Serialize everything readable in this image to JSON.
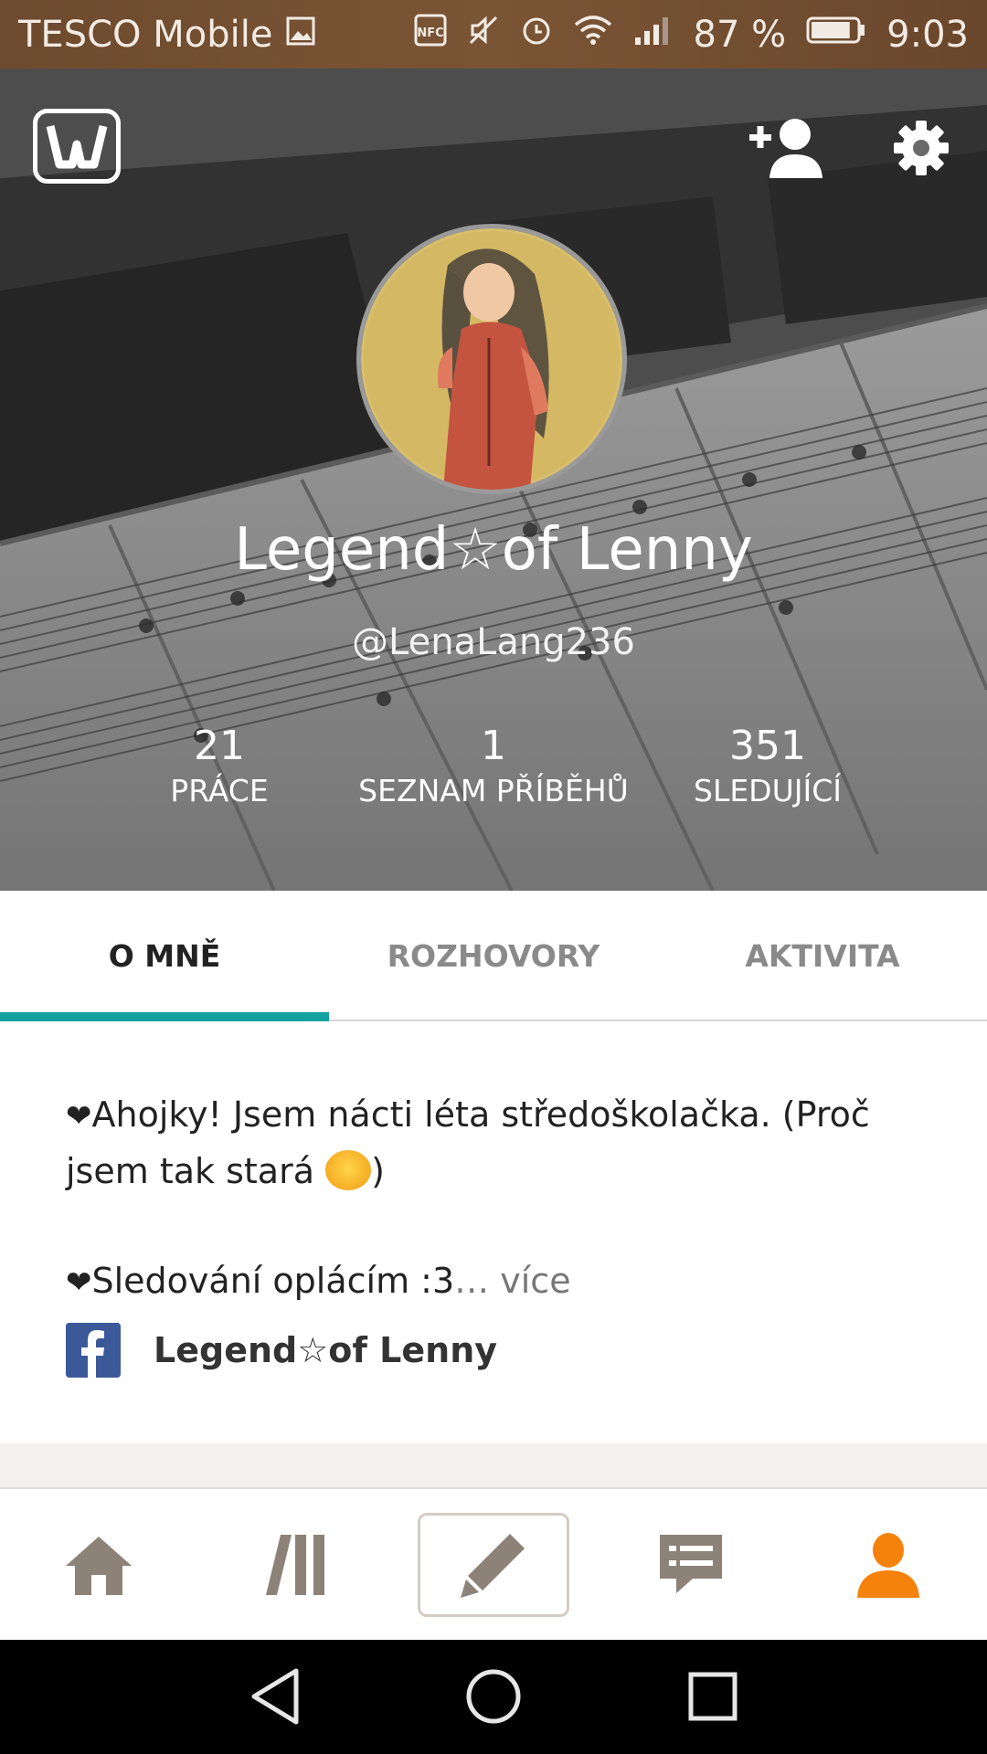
{
  "status_bar": {
    "carrier": "TESCO Mobile",
    "battery_percent": "87 %",
    "battery_level": 0.87,
    "time": "9:03",
    "icons": [
      "image-icon",
      "nfc-icon",
      "mute-icon",
      "alarm-icon",
      "wifi-icon",
      "signal-icon",
      "battery-icon"
    ]
  },
  "header": {
    "logo_icon": "wattpad-logo-icon",
    "actions": [
      "add-friend-icon",
      "settings-gear-icon"
    ]
  },
  "profile": {
    "display_name": "Legend☆of Lenny",
    "username": "@LenaLang236",
    "stats": [
      {
        "value": "21",
        "label": "PRÁCE"
      },
      {
        "value": "1",
        "label": "SEZNAM PŘÍBĚHŮ"
      },
      {
        "value": "351",
        "label": "SLEDUJÍCÍ"
      }
    ]
  },
  "tabs": [
    {
      "label": "O MNĚ",
      "active": true
    },
    {
      "label": "ROZHOVORY",
      "active": false
    },
    {
      "label": "AKTIVITA",
      "active": false
    }
  ],
  "about": {
    "line1": "Ahojky! Jsem nácti léta středoškolačka. (Proč jsem tak stará ",
    "line1_end": ")",
    "line2": "Sledování oplácím :3",
    "ellipsis": "…",
    "more": "více",
    "facebook_name": "Legend☆of Lenny"
  },
  "bottom_nav": [
    "home-icon",
    "library-icon",
    "write-icon",
    "messages-icon",
    "profile-icon"
  ],
  "colors": {
    "accent_teal": "#13a2a0",
    "nav_gray": "#8c8278",
    "nav_active_orange": "#f5820b",
    "facebook_blue": "#3b5998"
  }
}
